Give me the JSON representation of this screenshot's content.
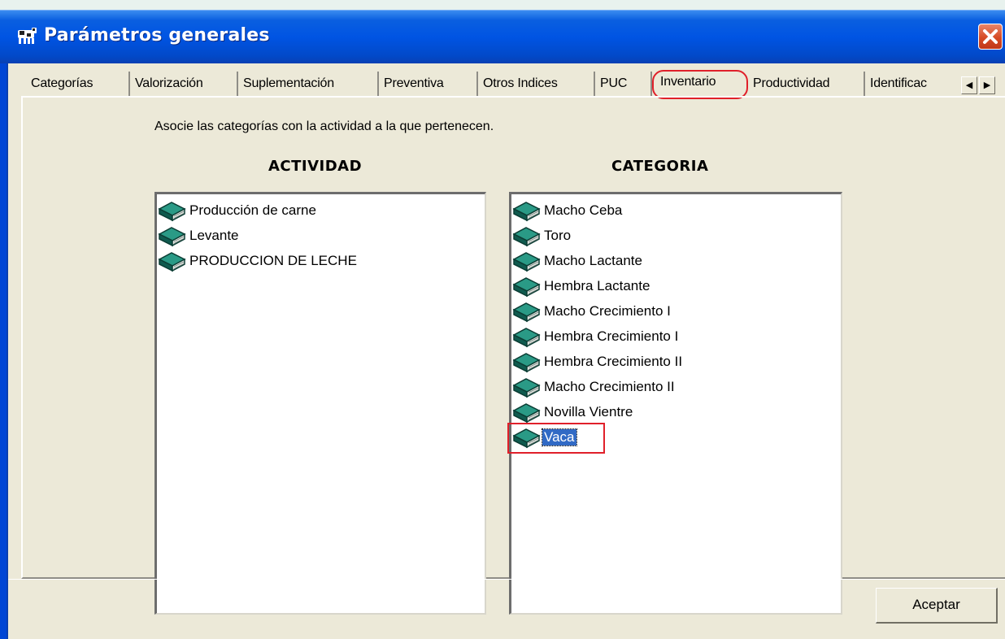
{
  "window": {
    "title": "Parámetros generales",
    "close_label": "✕"
  },
  "tabs": [
    {
      "label": "Categorías"
    },
    {
      "label": "Valorización"
    },
    {
      "label": "Suplementación"
    },
    {
      "label": "Preventiva"
    },
    {
      "label": "Otros Indices"
    },
    {
      "label": "PUC"
    },
    {
      "label": "Inventario",
      "active": true
    },
    {
      "label": "Productividad"
    },
    {
      "label": "Identificac"
    }
  ],
  "tab_scroll": {
    "left": "◀",
    "right": "▶"
  },
  "instruction": "Asocie las categorías con la actividad a la que pertenecen.",
  "actividad": {
    "header": "ACTIVIDAD",
    "items": [
      "Producción de carne",
      "Levante",
      "PRODUCCION DE LECHE"
    ]
  },
  "categoria": {
    "header": "CATEGORIA",
    "items": [
      "Macho Ceba",
      "Toro",
      "Macho Lactante",
      "Hembra Lactante",
      "Macho Crecimiento I",
      "Hembra Crecimiento I",
      "Hembra Crecimiento II",
      "Macho Crecimiento II",
      "Novilla Vientre",
      "Vaca"
    ],
    "selected": "Vaca"
  },
  "buttons": {
    "accept": "Aceptar"
  },
  "colors": {
    "titlebar": "#0054e3",
    "selection": "#316ac5",
    "highlight": "#e0202a",
    "book": "#1a7a6a"
  }
}
